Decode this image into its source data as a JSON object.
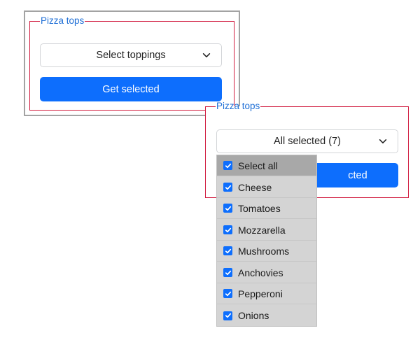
{
  "widget_one": {
    "legend": "Pizza tops",
    "select_text": "Select toppings",
    "button_label": "Get selected"
  },
  "widget_two": {
    "legend": "Pizza tops",
    "select_text": "All selected (7)",
    "button_label": "Get selected",
    "button_visible_text": "cted"
  },
  "dropdown": {
    "options": [
      {
        "label": "Select all",
        "checked": true,
        "highlighted": true
      },
      {
        "label": "Cheese",
        "checked": true
      },
      {
        "label": "Tomatoes",
        "checked": true
      },
      {
        "label": "Mozzarella",
        "checked": true
      },
      {
        "label": "Mushrooms",
        "checked": true
      },
      {
        "label": "Anchovies",
        "checked": true
      },
      {
        "label": "Pepperoni",
        "checked": true
      },
      {
        "label": "Onions",
        "checked": true
      }
    ]
  },
  "colors": {
    "primary": "#0d6efd",
    "legend_text": "#1f6fd6",
    "fieldset_border": "#d11a3e",
    "dropdown_bg": "#d4d4d4",
    "dropdown_highlight": "#a8a8a8"
  },
  "icons": {
    "caret": "chevron-down-icon",
    "checkbox": "checkbox-checked-icon"
  }
}
